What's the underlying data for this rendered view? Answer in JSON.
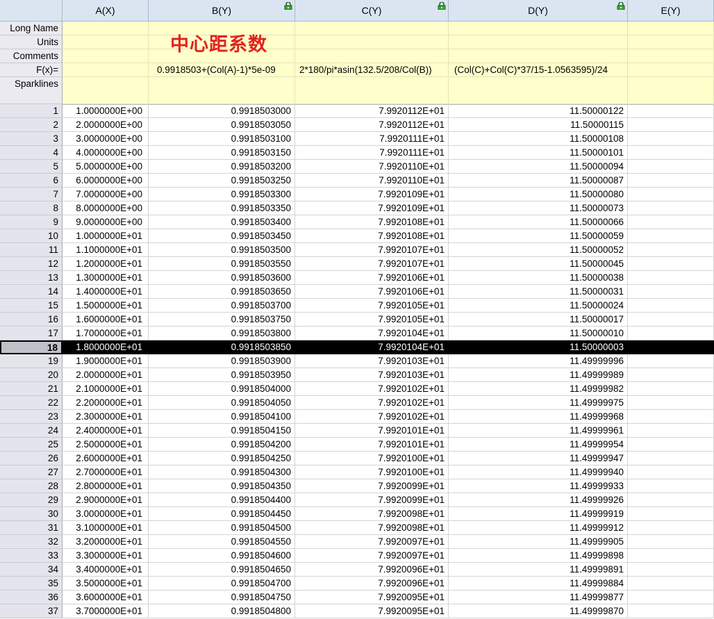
{
  "columns": [
    {
      "label": "A(X)",
      "locked": false
    },
    {
      "label": "B(Y)",
      "locked": true
    },
    {
      "label": "C(Y)",
      "locked": true
    },
    {
      "label": "D(Y)",
      "locked": true
    },
    {
      "label": "E(Y)",
      "locked": false
    }
  ],
  "labels": {
    "long_name": "Long Name",
    "units": "Units",
    "comments": "Comments",
    "fx": "F(x)=",
    "sparklines": "Sparklines"
  },
  "long_name_B": "中心距系数",
  "formulas": {
    "B": "0.9918503+(Col(A)-1)*5e-09",
    "C": "2*180/pi*asin(132.5/208/Col(B))",
    "D": "(Col(C)+Col(C)*37/15-1.0563595)/24"
  },
  "selected_row": 18,
  "rows": [
    {
      "n": "1",
      "a": "1.0000000E+00",
      "b": "0.9918503000",
      "c": "7.9920112E+01",
      "d": "11.50000122"
    },
    {
      "n": "2",
      "a": "2.0000000E+00",
      "b": "0.9918503050",
      "c": "7.9920112E+01",
      "d": "11.50000115"
    },
    {
      "n": "3",
      "a": "3.0000000E+00",
      "b": "0.9918503100",
      "c": "7.9920111E+01",
      "d": "11.50000108"
    },
    {
      "n": "4",
      "a": "4.0000000E+00",
      "b": "0.9918503150",
      "c": "7.9920111E+01",
      "d": "11.50000101"
    },
    {
      "n": "5",
      "a": "5.0000000E+00",
      "b": "0.9918503200",
      "c": "7.9920110E+01",
      "d": "11.50000094"
    },
    {
      "n": "6",
      "a": "6.0000000E+00",
      "b": "0.9918503250",
      "c": "7.9920110E+01",
      "d": "11.50000087"
    },
    {
      "n": "7",
      "a": "7.0000000E+00",
      "b": "0.9918503300",
      "c": "7.9920109E+01",
      "d": "11.50000080"
    },
    {
      "n": "8",
      "a": "8.0000000E+00",
      "b": "0.9918503350",
      "c": "7.9920109E+01",
      "d": "11.50000073"
    },
    {
      "n": "9",
      "a": "9.0000000E+00",
      "b": "0.9918503400",
      "c": "7.9920108E+01",
      "d": "11.50000066"
    },
    {
      "n": "10",
      "a": "1.0000000E+01",
      "b": "0.9918503450",
      "c": "7.9920108E+01",
      "d": "11.50000059"
    },
    {
      "n": "11",
      "a": "1.1000000E+01",
      "b": "0.9918503500",
      "c": "7.9920107E+01",
      "d": "11.50000052"
    },
    {
      "n": "12",
      "a": "1.2000000E+01",
      "b": "0.9918503550",
      "c": "7.9920107E+01",
      "d": "11.50000045"
    },
    {
      "n": "13",
      "a": "1.3000000E+01",
      "b": "0.9918503600",
      "c": "7.9920106E+01",
      "d": "11.50000038"
    },
    {
      "n": "14",
      "a": "1.4000000E+01",
      "b": "0.9918503650",
      "c": "7.9920106E+01",
      "d": "11.50000031"
    },
    {
      "n": "15",
      "a": "1.5000000E+01",
      "b": "0.9918503700",
      "c": "7.9920105E+01",
      "d": "11.50000024"
    },
    {
      "n": "16",
      "a": "1.6000000E+01",
      "b": "0.9918503750",
      "c": "7.9920105E+01",
      "d": "11.50000017"
    },
    {
      "n": "17",
      "a": "1.7000000E+01",
      "b": "0.9918503800",
      "c": "7.9920104E+01",
      "d": "11.50000010"
    },
    {
      "n": "18",
      "a": "1.8000000E+01",
      "b": "0.9918503850",
      "c": "7.9920104E+01",
      "d": "11.50000003"
    },
    {
      "n": "19",
      "a": "1.9000000E+01",
      "b": "0.9918503900",
      "c": "7.9920103E+01",
      "d": "11.49999996"
    },
    {
      "n": "20",
      "a": "2.0000000E+01",
      "b": "0.9918503950",
      "c": "7.9920103E+01",
      "d": "11.49999989"
    },
    {
      "n": "21",
      "a": "2.1000000E+01",
      "b": "0.9918504000",
      "c": "7.9920102E+01",
      "d": "11.49999982"
    },
    {
      "n": "22",
      "a": "2.2000000E+01",
      "b": "0.9918504050",
      "c": "7.9920102E+01",
      "d": "11.49999975"
    },
    {
      "n": "23",
      "a": "2.3000000E+01",
      "b": "0.9918504100",
      "c": "7.9920102E+01",
      "d": "11.49999968"
    },
    {
      "n": "24",
      "a": "2.4000000E+01",
      "b": "0.9918504150",
      "c": "7.9920101E+01",
      "d": "11.49999961"
    },
    {
      "n": "25",
      "a": "2.5000000E+01",
      "b": "0.9918504200",
      "c": "7.9920101E+01",
      "d": "11.49999954"
    },
    {
      "n": "26",
      "a": "2.6000000E+01",
      "b": "0.9918504250",
      "c": "7.9920100E+01",
      "d": "11.49999947"
    },
    {
      "n": "27",
      "a": "2.7000000E+01",
      "b": "0.9918504300",
      "c": "7.9920100E+01",
      "d": "11.49999940"
    },
    {
      "n": "28",
      "a": "2.8000000E+01",
      "b": "0.9918504350",
      "c": "7.9920099E+01",
      "d": "11.49999933"
    },
    {
      "n": "29",
      "a": "2.9000000E+01",
      "b": "0.9918504400",
      "c": "7.9920099E+01",
      "d": "11.49999926"
    },
    {
      "n": "30",
      "a": "3.0000000E+01",
      "b": "0.9918504450",
      "c": "7.9920098E+01",
      "d": "11.49999919"
    },
    {
      "n": "31",
      "a": "3.1000000E+01",
      "b": "0.9918504500",
      "c": "7.9920098E+01",
      "d": "11.49999912"
    },
    {
      "n": "32",
      "a": "3.2000000E+01",
      "b": "0.9918504550",
      "c": "7.9920097E+01",
      "d": "11.49999905"
    },
    {
      "n": "33",
      "a": "3.3000000E+01",
      "b": "0.9918504600",
      "c": "7.9920097E+01",
      "d": "11.49999898"
    },
    {
      "n": "34",
      "a": "3.4000000E+01",
      "b": "0.9918504650",
      "c": "7.9920096E+01",
      "d": "11.49999891"
    },
    {
      "n": "35",
      "a": "3.5000000E+01",
      "b": "0.9918504700",
      "c": "7.9920096E+01",
      "d": "11.49999884"
    },
    {
      "n": "36",
      "a": "3.6000000E+01",
      "b": "0.9918504750",
      "c": "7.9920095E+01",
      "d": "11.49999877"
    },
    {
      "n": "37",
      "a": "3.7000000E+01",
      "b": "0.9918504800",
      "c": "7.9920095E+01",
      "d": "11.49999870"
    }
  ]
}
